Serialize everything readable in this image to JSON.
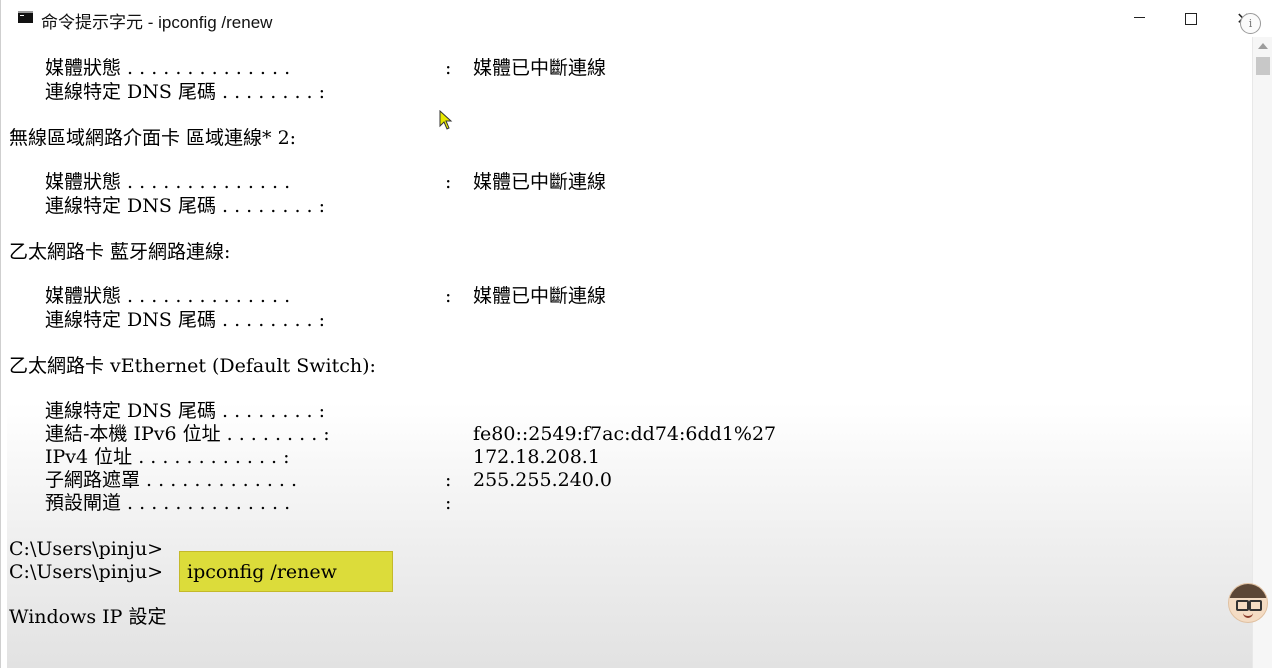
{
  "window": {
    "title": "命令提示字元 - ipconfig  /renew",
    "min_glyph": "—",
    "close_glyph": "✕",
    "info_glyph": "i"
  },
  "console": {
    "groups": [
      {
        "rows": [
          {
            "key": "媒體狀態 . . . . . . . . . . . . . .",
            "value": "媒體已中斷連線"
          },
          {
            "key": "連線特定 DNS 尾碼 . . . . . . . . :",
            "value": ""
          }
        ]
      },
      {
        "header": "無線區域網路介面卡 區域連線* 2:",
        "rows": [
          {
            "key": "媒體狀態 . . . . . . . . . . . . . .",
            "value": "媒體已中斷連線"
          },
          {
            "key": "連線特定 DNS 尾碼 . . . . . . . . :",
            "value": ""
          }
        ]
      },
      {
        "header": "乙太網路卡 藍牙網路連線:",
        "rows": [
          {
            "key": "媒體狀態 . . . . . . . . . . . . . .",
            "value": "媒體已中斷連線"
          },
          {
            "key": "連線特定 DNS 尾碼 . . . . . . . . :",
            "value": ""
          }
        ]
      },
      {
        "header": "乙太網路卡 vEthernet (Default Switch):",
        "rows": [
          {
            "key": "連線特定 DNS 尾碼 . . . . . . . . :",
            "value": ""
          },
          {
            "key": "連結-本機 IPv6 位址 . . . . . . . . :",
            "value": "fe80::2549:f7ac:dd74:6dd1%27"
          },
          {
            "key": "IPv4 位址 . . . . . . . . . . . . :",
            "value": "172.18.208.1"
          },
          {
            "key": "子網路遮罩 . . . . . . . . . . . . .",
            "value": "255.255.240.0"
          },
          {
            "key": "預設閘道 . . . . . . . . . . . . . .",
            "value": ""
          }
        ]
      }
    ],
    "colons": [
      ":",
      ":",
      ":",
      ":",
      ":"
    ],
    "prompt_1": "C:\\Users\\pinju>",
    "prompt_2": "C:\\Users\\pinju>",
    "command": "ipconfig /renew",
    "result_header": "Windows IP 設定"
  },
  "colors": {
    "highlight": "#dcdc3a",
    "text": "#000000",
    "background": "#ffffff"
  },
  "icons": {
    "app": "terminal-icon",
    "cursor": "mouse-pointer-icon",
    "avatar": "user-avatar-icon"
  }
}
